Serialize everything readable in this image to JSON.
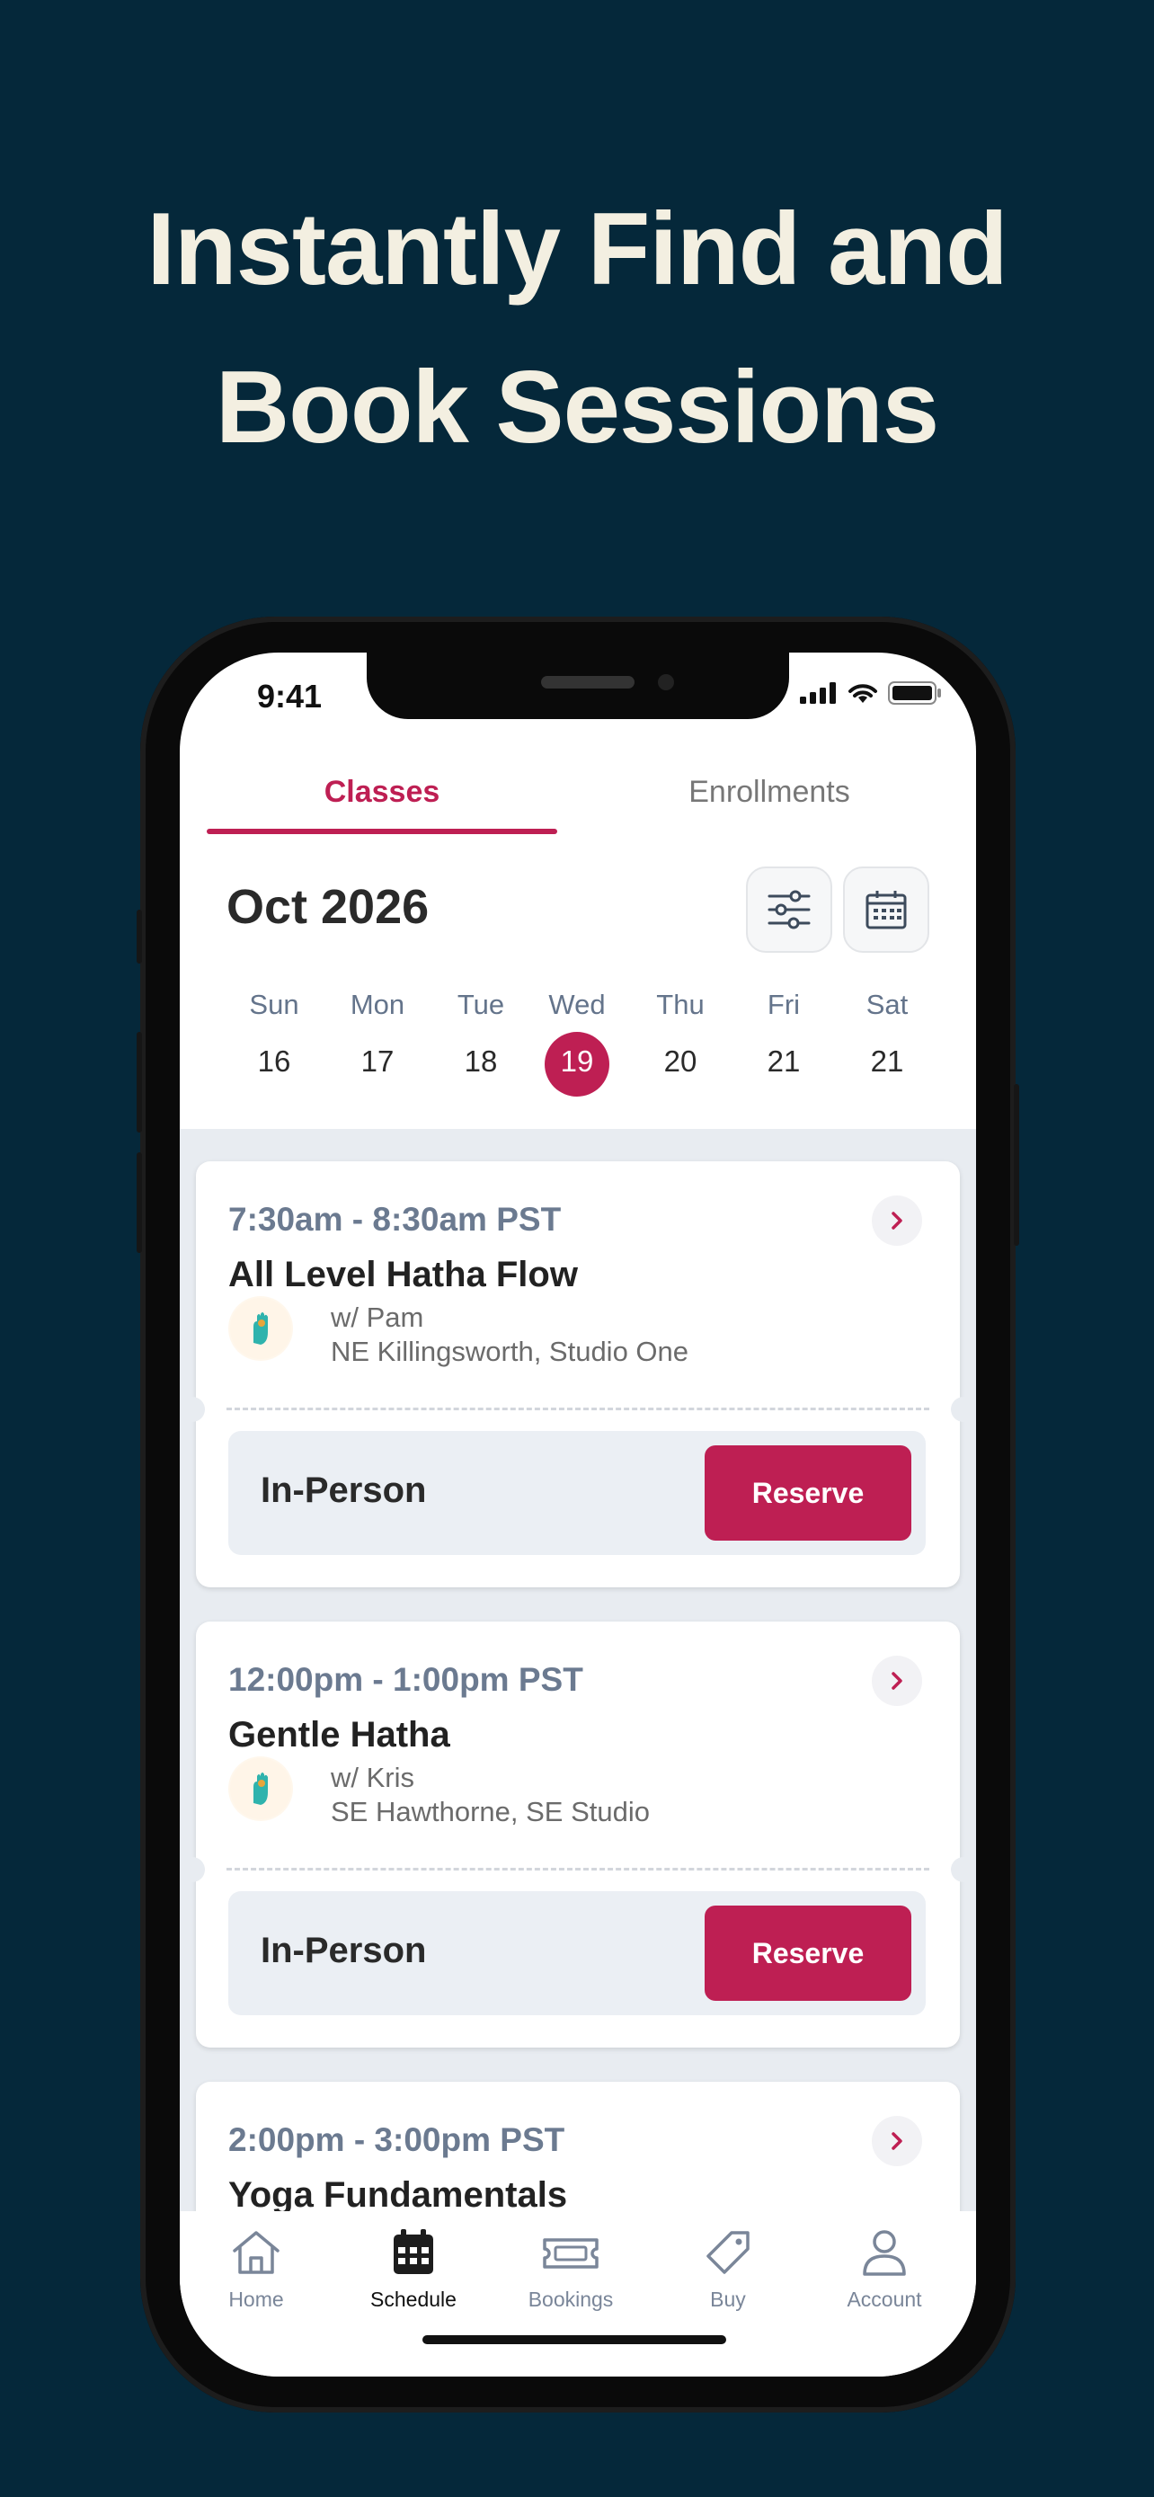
{
  "headline": {
    "line1": "Instantly Find and",
    "line2": "Book Sessions"
  },
  "status_bar": {
    "time": "9:41"
  },
  "tabs": {
    "classes": "Classes",
    "enrollments": "Enrollments"
  },
  "calendar": {
    "month": "Oct 2026",
    "days": [
      {
        "name": "Sun",
        "num": "16"
      },
      {
        "name": "Mon",
        "num": "17"
      },
      {
        "name": "Tue",
        "num": "18"
      },
      {
        "name": "Wed",
        "num": "19"
      },
      {
        "name": "Thu",
        "num": "20"
      },
      {
        "name": "Fri",
        "num": "21"
      },
      {
        "name": "Sat",
        "num": "21"
      }
    ],
    "selected_index": 3
  },
  "classes": [
    {
      "time": "7:30am - 8:30am PST",
      "title": "All Level Hatha Flow",
      "instructor": "w/ Pam",
      "location": "NE Killingsworth, Studio One",
      "mode": "In-Person",
      "action": "Reserve"
    },
    {
      "time": "12:00pm - 1:00pm PST",
      "title": "Gentle Hatha",
      "instructor": "w/ Kris",
      "location": "SE Hawthorne, SE Studio",
      "mode": "In-Person",
      "action": "Reserve"
    },
    {
      "time": "2:00pm - 3:00pm PST",
      "title": "Yoga Fundamentals"
    }
  ],
  "tabbar": {
    "items": [
      {
        "label": "Home",
        "icon": "home-icon"
      },
      {
        "label": "Schedule",
        "icon": "calendar-icon"
      },
      {
        "label": "Bookings",
        "icon": "ticket-icon"
      },
      {
        "label": "Buy",
        "icon": "tag-icon"
      },
      {
        "label": "Account",
        "icon": "person-icon"
      }
    ],
    "active_index": 1
  },
  "colors": {
    "background": "#05283a",
    "accent": "#be1f53",
    "headline": "#f3efe1"
  }
}
